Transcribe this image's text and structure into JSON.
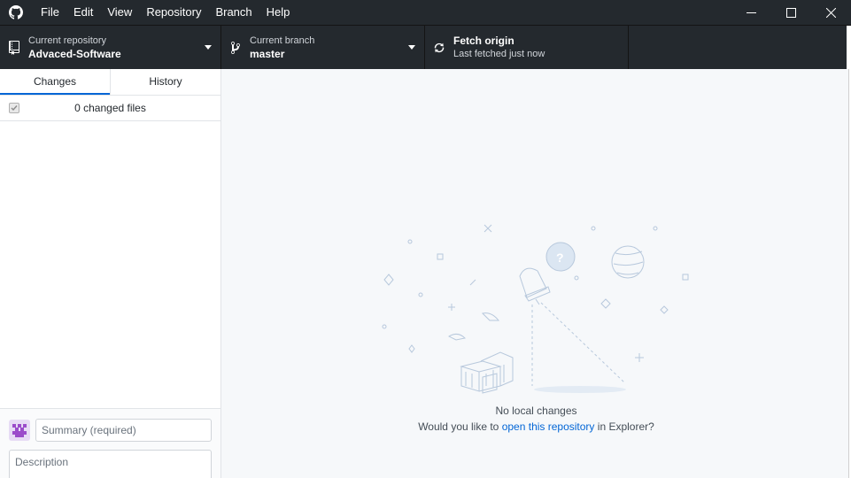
{
  "menu": {
    "items": [
      "File",
      "Edit",
      "View",
      "Repository",
      "Branch",
      "Help"
    ]
  },
  "toolbar": {
    "repo_label": "Current repository",
    "repo_value": "Advaced-Software",
    "branch_label": "Current branch",
    "branch_value": "master",
    "fetch_title": "Fetch origin",
    "fetch_sub": "Last fetched just now"
  },
  "sidebar": {
    "tabs": [
      {
        "label": "Changes",
        "active": true
      },
      {
        "label": "History",
        "active": false
      }
    ],
    "changed_files": "0 changed files",
    "summary_placeholder": "Summary (required)",
    "description_placeholder": "Description"
  },
  "main": {
    "empty_title": "No local changes",
    "prompt_prefix": "Would you like to",
    "prompt_link": "open this repository",
    "prompt_suffix": "in Explorer?"
  },
  "colors": {
    "titlebar": "#24292e",
    "accent": "#0366d6",
    "main_bg": "#f6f8fa"
  },
  "icons": [
    "github-logo-icon",
    "repo-icon",
    "branch-icon",
    "sync-icon",
    "minimize-icon",
    "maximize-icon",
    "close-icon",
    "checkbox-icon",
    "avatar-icon"
  ]
}
